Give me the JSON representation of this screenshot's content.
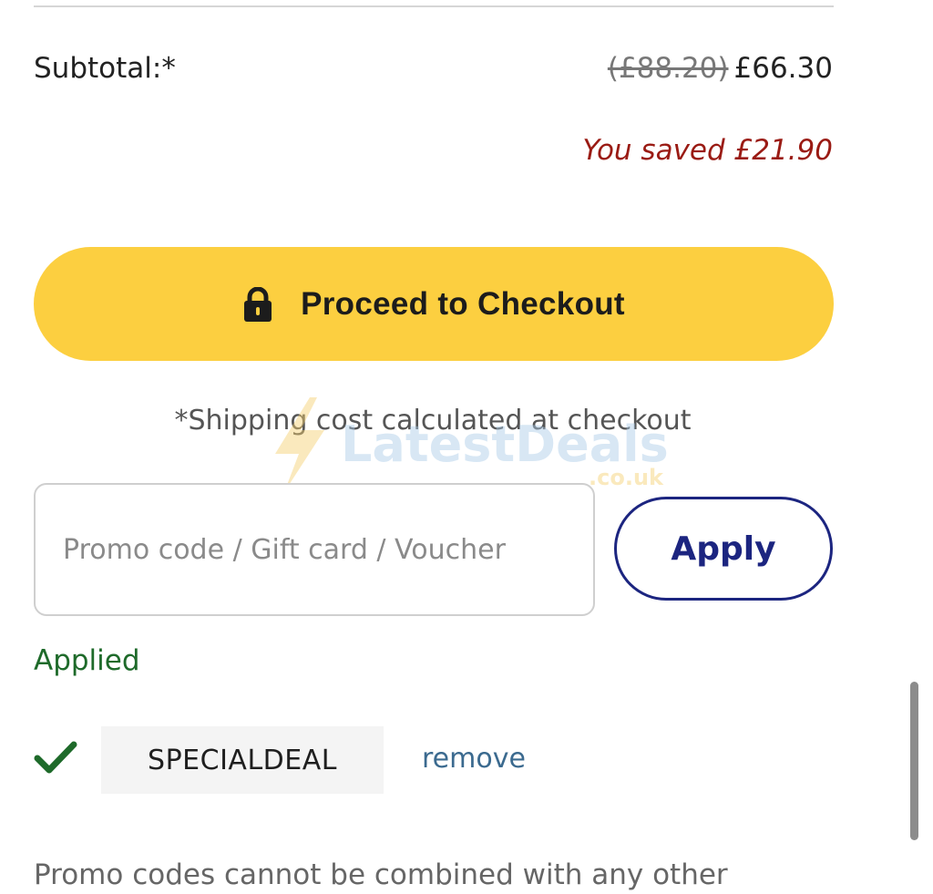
{
  "subtotal": {
    "label": "Subtotal:*",
    "original_price": "(£88.20)",
    "price": "£66.30",
    "savings_text": "You saved £21.90"
  },
  "checkout": {
    "icon": "lock-icon",
    "label": "Proceed to Checkout",
    "color": "#fccf40"
  },
  "shipping_note": "*Shipping cost calculated at checkout",
  "watermark": {
    "brand": "LatestDeals",
    "suffix": ".co.uk"
  },
  "promo": {
    "placeholder": "Promo code / Gift card / Voucher",
    "value": "",
    "apply_label": "Apply",
    "apply_color": "#1c2580"
  },
  "applied": {
    "heading": "Applied",
    "status_icon": "check-icon",
    "code": "SPECIALDEAL",
    "remove_label": "remove"
  },
  "disclaimer": "Promo codes cannot be combined with any other",
  "colors": {
    "savings": "#9a1b14",
    "applied": "#1e6a2a",
    "link": "#3b6a8f"
  }
}
